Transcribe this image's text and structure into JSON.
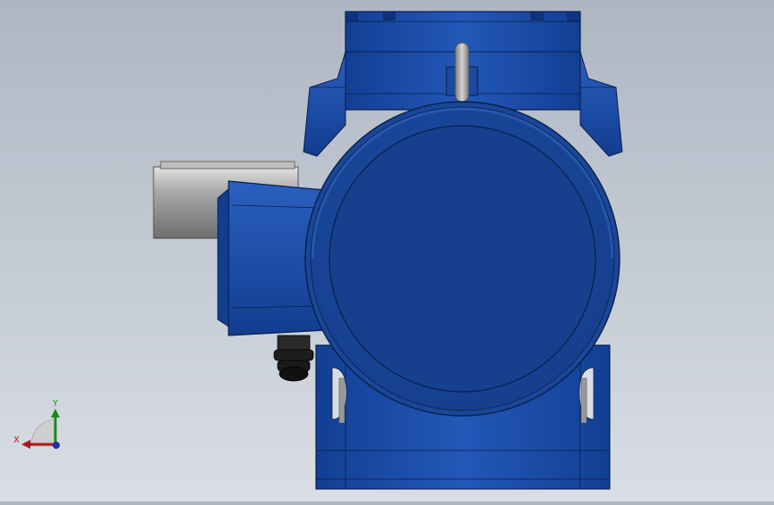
{
  "viewport": {
    "background_top": "#aeb6c2",
    "background_bottom": "#d9dee5"
  },
  "model": {
    "body_color": "#1f4fa6",
    "body_dark": "#0f3a8c",
    "edge_color": "#0a1f4a",
    "shaft_color": "#8f8f8f",
    "gland_color": "#1a1a1a",
    "lifting_eye_color": "#9a9a9a"
  },
  "triad": {
    "x_label": "X",
    "y_label": "Y",
    "x_color": "#b01818",
    "y_color": "#1a8a1a",
    "z_color": "#1c2fa8",
    "x_icon": "x-axis-arrow",
    "y_icon": "y-axis-arrow",
    "z_icon": "z-axis-dot"
  }
}
